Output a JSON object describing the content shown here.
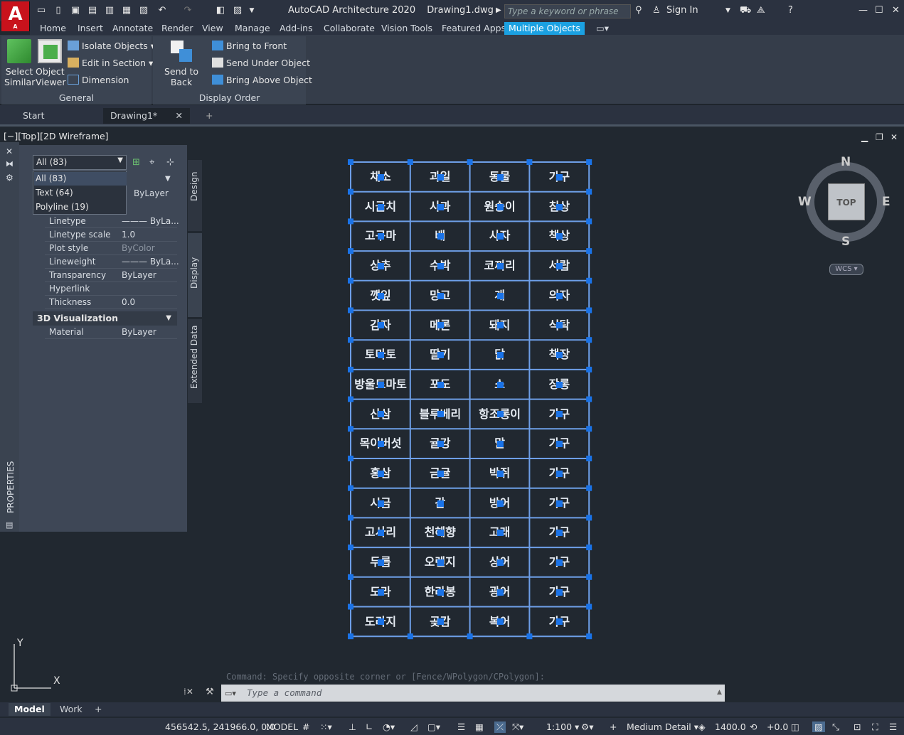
{
  "app": {
    "title": "AutoCAD Architecture 2020",
    "drawing": "Drawing1.dwg",
    "logo_letter": "A",
    "logo_sub": "A",
    "search_placeholder": "Type a keyword or phrase",
    "sign_in": "Sign In"
  },
  "ribbon_tabs": [
    "Home",
    "Insert",
    "Annotate",
    "Render",
    "View",
    "Manage",
    "Add-ins",
    "Collaborate",
    "Vision Tools",
    "Featured Apps",
    "Multiple Objects"
  ],
  "ribbon_active_tab": "Multiple Objects",
  "general_panel": {
    "title": "General",
    "select_similar": [
      "Select",
      "Similar"
    ],
    "object_viewer": [
      "Object",
      "Viewer"
    ],
    "isolate_objects": "Isolate Objects",
    "edit_in_section": "Edit in Section",
    "dimension": "Dimension"
  },
  "display_order_panel": {
    "title": "Display Order",
    "send_to_back": "Send to Back",
    "bring_to_front": "Bring to Front",
    "send_under_object": "Send Under Object",
    "bring_above_object": "Bring Above Object"
  },
  "doc_tabs": [
    "Start",
    "Drawing1*"
  ],
  "viewport_label": "[−][Top][2D Wireframe]",
  "properties": {
    "palette_title": "PROPERTIES",
    "selection": "All (83)",
    "dropdown_options": [
      "All (83)",
      "Text (64)",
      "Polyline (19)"
    ],
    "side_tabs": [
      "Design",
      "Display",
      "Extended Data"
    ],
    "layer_value": "ByLayer",
    "rows": [
      {
        "k": "Linetype",
        "v": "——— ByLa..."
      },
      {
        "k": "Linetype scale",
        "v": "1.0"
      },
      {
        "k": "Plot style",
        "v": "ByColor"
      },
      {
        "k": "Lineweight",
        "v": "——— ByLa..."
      },
      {
        "k": "Transparency",
        "v": "ByLayer"
      },
      {
        "k": "Hyperlink",
        "v": ""
      },
      {
        "k": "Thickness",
        "v": "0.0"
      }
    ],
    "section_3d": "3D Visualization",
    "material_key": "Material",
    "material_value": "ByLayer"
  },
  "drawing_cells": [
    [
      "채소",
      "과일",
      "동물",
      "가구"
    ],
    [
      "시금치",
      "사과",
      "원숭이",
      "침상"
    ],
    [
      "고구마",
      "배",
      "사자",
      "책상"
    ],
    [
      "상추",
      "수박",
      "코끼리",
      "서랍"
    ],
    [
      "깻잎",
      "망고",
      "개",
      "의자"
    ],
    [
      "감자",
      "메론",
      "돼지",
      "식탁"
    ],
    [
      "토마토",
      "딸기",
      "닭",
      "책장"
    ],
    [
      "방울토마토",
      "포도",
      "소",
      "장롱"
    ],
    [
      "산삼",
      "블루베리",
      "항조롱이",
      "가구"
    ],
    [
      "목이버섯",
      "귤강",
      "말",
      "가구"
    ],
    [
      "홍삼",
      "금귤",
      "박쥐",
      "가구"
    ],
    [
      "시금",
      "감",
      "방어",
      "가구"
    ],
    [
      "고사리",
      "천혜향",
      "고래",
      "가구"
    ],
    [
      "두릅",
      "오렌지",
      "상어",
      "가구"
    ],
    [
      "도라",
      "한라봉",
      "광어",
      "가구"
    ],
    [
      "도라지",
      "곶감",
      "복어",
      "가구"
    ]
  ],
  "viewcube": {
    "top": "TOP",
    "n": "N",
    "s": "S",
    "e": "E",
    "w": "W",
    "wcs": "WCS"
  },
  "ucs": {
    "x": "X",
    "y": "Y"
  },
  "command": {
    "history": "Command: Specify opposite corner or [Fence/WPolygon/CPolygon]:",
    "placeholder": "Type a command"
  },
  "layout_tabs": [
    "Model",
    "Work"
  ],
  "status": {
    "coords": "456542.5, 241966.0, 0.0",
    "model": "MODEL",
    "scale": "1:100",
    "detail": "Medium Detail",
    "elevation": "1400.0",
    "offset": "+0.0"
  }
}
